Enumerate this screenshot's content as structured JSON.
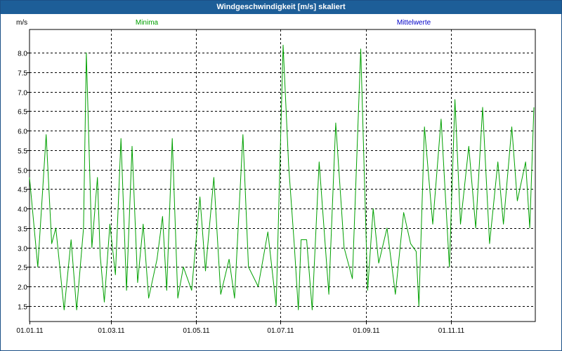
{
  "window": {
    "title": "Windgeschwindigkeit [m/s] skaliert"
  },
  "colors": {
    "title_bar": "#1d5e98",
    "series_minima": "#00a000",
    "series_mittelwerte": "#0000c8",
    "grid": "#000000"
  },
  "chart_data": {
    "type": "line",
    "title": "Windgeschwindigkeit [m/s] skaliert",
    "ylabel": "m/s",
    "xlabel": "",
    "ylim": [
      1.1,
      8.6
    ],
    "yticks": [
      1.5,
      2.0,
      2.5,
      3.0,
      3.5,
      4.0,
      4.5,
      5.0,
      5.5,
      6.0,
      6.5,
      7.0,
      7.5,
      8.0
    ],
    "yticklabels": [
      "1.5",
      "2.0",
      "2.5",
      "3.0",
      "3.5",
      "4.0",
      "4.5",
      "5.0",
      "5.5",
      "6.0",
      "6.5",
      "7.0",
      "7.5",
      "8.0"
    ],
    "xlim": [
      "2011-01-01",
      "2012-01-01"
    ],
    "xticks": [
      "2011-01-01",
      "2011-03-01",
      "2011-05-01",
      "2011-07-01",
      "2011-09-01",
      "2011-11-01"
    ],
    "xticklabels": [
      "01.01.11",
      "01.03.11",
      "01.05.11",
      "01.07.11",
      "01.09.11",
      "01.11.11"
    ],
    "grid": true,
    "legend": [
      {
        "name": "Minima",
        "color": "#00a000"
      },
      {
        "name": "Mittelwerte",
        "color": "#0000c8"
      }
    ],
    "series": [
      {
        "name": "Minima",
        "color": "#00a000",
        "x": [
          "2011-01-01",
          "2011-01-07",
          "2011-01-13",
          "2011-01-17",
          "2011-01-20",
          "2011-01-26",
          "2011-01-31",
          "2011-02-04",
          "2011-02-09",
          "2011-02-11",
          "2011-02-15",
          "2011-02-19",
          "2011-02-21",
          "2011-02-24",
          "2011-02-28",
          "2011-03-04",
          "2011-03-08",
          "2011-03-12",
          "2011-03-16",
          "2011-03-20",
          "2011-03-24",
          "2011-03-28",
          "2011-04-03",
          "2011-04-07",
          "2011-04-10",
          "2011-04-14",
          "2011-04-18",
          "2011-04-22",
          "2011-04-28",
          "2011-05-04",
          "2011-05-08",
          "2011-05-14",
          "2011-05-19",
          "2011-05-25",
          "2011-05-29",
          "2011-06-04",
          "2011-06-08",
          "2011-06-15",
          "2011-06-22",
          "2011-06-28",
          "2011-07-03",
          "2011-07-07",
          "2011-07-11",
          "2011-07-14",
          "2011-07-16",
          "2011-07-20",
          "2011-07-24",
          "2011-07-29",
          "2011-08-05",
          "2011-08-10",
          "2011-08-16",
          "2011-08-22",
          "2011-08-28",
          "2011-09-02",
          "2011-09-06",
          "2011-09-10",
          "2011-09-16",
          "2011-09-22",
          "2011-09-28",
          "2011-10-03",
          "2011-10-07",
          "2011-10-09",
          "2011-10-13",
          "2011-10-19",
          "2011-10-25",
          "2011-10-31",
          "2011-11-04",
          "2011-11-08",
          "2011-11-14",
          "2011-11-19",
          "2011-11-24",
          "2011-11-29",
          "2011-12-05",
          "2011-12-09",
          "2011-12-15",
          "2011-12-19",
          "2011-12-25",
          "2011-12-28",
          "2011-12-31"
        ],
        "y": [
          4.8,
          2.5,
          5.9,
          3.1,
          3.5,
          1.4,
          3.2,
          1.4,
          3.5,
          8.0,
          3.0,
          4.8,
          2.8,
          1.6,
          3.6,
          2.3,
          5.8,
          1.9,
          5.6,
          2.1,
          3.6,
          1.7,
          2.7,
          3.8,
          1.9,
          5.8,
          1.7,
          2.5,
          1.9,
          4.3,
          2.4,
          4.8,
          1.8,
          2.7,
          1.7,
          5.9,
          2.5,
          2.0,
          3.4,
          1.5,
          8.2,
          5.1,
          3.1,
          1.4,
          3.2,
          3.2,
          1.4,
          5.2,
          1.8,
          6.2,
          3.0,
          2.2,
          8.1,
          1.9,
          4.0,
          2.6,
          3.5,
          1.8,
          3.9,
          3.1,
          2.9,
          1.5,
          6.1,
          3.6,
          6.3,
          2.5,
          6.8,
          3.6,
          5.6,
          3.5,
          6.6,
          3.1,
          5.2,
          3.6,
          6.1,
          4.2,
          5.2,
          3.5,
          6.6
        ]
      },
      {
        "name": "Mittelwerte",
        "color": "#0000c8",
        "x": [],
        "y": []
      }
    ]
  }
}
